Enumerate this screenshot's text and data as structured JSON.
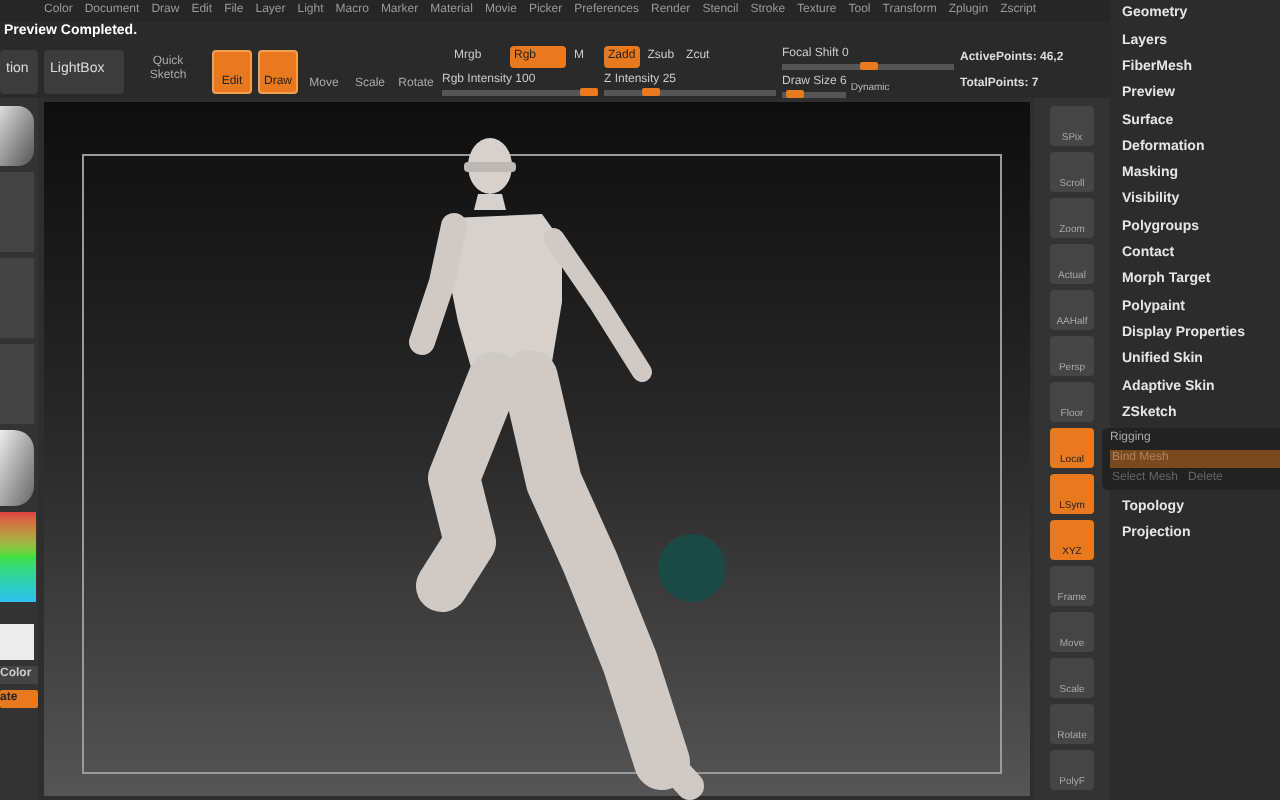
{
  "menu_bar": [
    "Color",
    "Document",
    "Draw",
    "Edit",
    "File",
    "Layer",
    "Light",
    "Macro",
    "Marker",
    "Material",
    "Movie",
    "Picker",
    "Preferences",
    "Render",
    "Stencil",
    "Stroke",
    "Texture",
    "Tool",
    "Transform",
    "Zplugin",
    "Zscript"
  ],
  "notice": "Preview Completed.",
  "toolbar": {
    "buttons": [
      {
        "label": "tion",
        "kind": "plain",
        "on": false
      },
      {
        "label": "LightBox",
        "kind": "plain",
        "on": false
      },
      {
        "label": "Quick Sketch",
        "kind": "icon",
        "on": false
      },
      {
        "label": "Edit",
        "kind": "icon",
        "on": true
      },
      {
        "label": "Draw",
        "kind": "icon",
        "on": true
      },
      {
        "label": "Move",
        "kind": "icon",
        "on": false
      },
      {
        "label": "Scale",
        "kind": "icon",
        "on": false
      },
      {
        "label": "Rotate",
        "kind": "icon",
        "on": false
      }
    ],
    "modes": [
      {
        "label": "Mrgb",
        "on": false,
        "disabled": false
      },
      {
        "label": "Rgb",
        "on": true,
        "disabled": false
      },
      {
        "label": "M",
        "on": false,
        "disabled": false
      },
      {
        "label": "Zadd",
        "on": true,
        "disabled": false
      },
      {
        "label": "Zsub",
        "on": false,
        "disabled": false
      },
      {
        "label": "Zcut",
        "on": false,
        "disabled": true
      }
    ],
    "sliders": [
      {
        "label": "Rgb Intensity 100",
        "level": 1.0
      },
      {
        "label": "Z Intensity 25",
        "level": 0.25
      },
      {
        "label": "Focal Shift 0",
        "level": 0.5
      },
      {
        "label": "Draw Size 6",
        "level": 0.1
      }
    ],
    "dynamic": "Dynamic",
    "stats": [
      "ActivePoints: 46,2",
      "TotalPoints: 7"
    ]
  },
  "left_shelf": {
    "color_label": "Color",
    "button": "ate"
  },
  "right_shelf": [
    {
      "label": "SPix",
      "on": false
    },
    {
      "label": "Scroll",
      "on": false
    },
    {
      "label": "Zoom",
      "on": false
    },
    {
      "label": "Actual",
      "on": false
    },
    {
      "label": "AAHalf",
      "on": false
    },
    {
      "label": "Persp",
      "on": false
    },
    {
      "label": "Floor",
      "on": false
    },
    {
      "label": "Local",
      "on": true
    },
    {
      "label": "LSym",
      "on": true
    },
    {
      "label": "XYZ",
      "on": true
    },
    {
      "label": "Frame",
      "on": false
    },
    {
      "label": "Move",
      "on": false
    },
    {
      "label": "Scale",
      "on": false
    },
    {
      "label": "Rotate",
      "on": false
    },
    {
      "label": "PolyF",
      "on": false
    }
  ],
  "palette": [
    {
      "kind": "item",
      "label": "Geometry"
    },
    {
      "kind": "item",
      "label": "Layers"
    },
    {
      "kind": "item",
      "label": "FiberMesh"
    },
    {
      "kind": "item",
      "label": "Preview"
    },
    {
      "kind": "item",
      "label": "Surface"
    },
    {
      "kind": "item",
      "label": "Deformation"
    },
    {
      "kind": "item",
      "label": "Masking"
    },
    {
      "kind": "item",
      "label": "Visibility"
    },
    {
      "kind": "item",
      "label": "Polygroups"
    },
    {
      "kind": "item",
      "label": "Contact"
    },
    {
      "kind": "item",
      "label": "Morph Target"
    },
    {
      "kind": "item",
      "label": "Polypaint"
    },
    {
      "kind": "item",
      "label": "Display Properties"
    },
    {
      "kind": "item",
      "label": "Unified Skin"
    },
    {
      "kind": "item",
      "label": "Adaptive Skin"
    },
    {
      "kind": "item",
      "label": "ZSketch"
    },
    {
      "kind": "group",
      "label": "Rigging",
      "buttons": [
        {
          "label": "Bind Mesh",
          "selected": true
        },
        {
          "label": "Select Mesh",
          "selected": false
        },
        {
          "label": "Delete",
          "selected": false
        }
      ]
    },
    {
      "kind": "item",
      "label": "Topology"
    },
    {
      "kind": "item",
      "label": "Projection"
    }
  ]
}
